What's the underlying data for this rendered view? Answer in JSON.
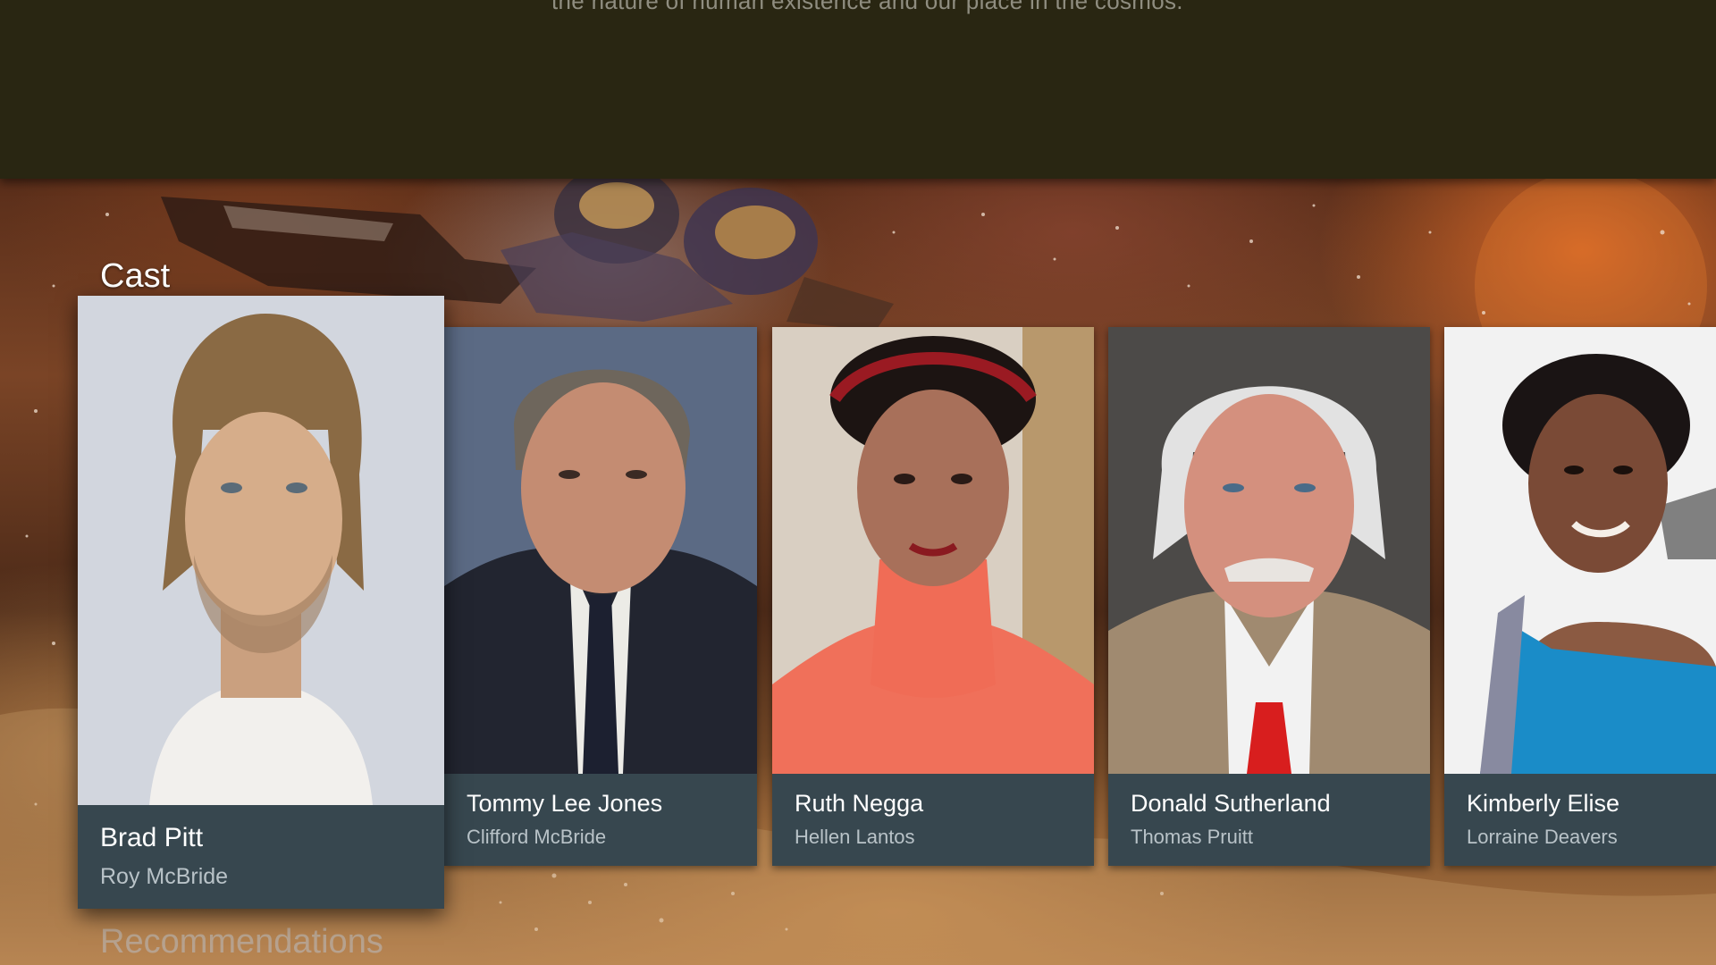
{
  "overview": {
    "text": "the nature of human existence and our place in the cosmos."
  },
  "sections": {
    "cast_title": "Cast",
    "recommendations_title": "Recommendations"
  },
  "cast": [
    {
      "actor": "Brad Pitt",
      "character": "Roy McBride"
    },
    {
      "actor": "Tommy Lee Jones",
      "character": "Clifford McBride"
    },
    {
      "actor": "Ruth Negga",
      "character": "Hellen Lantos"
    },
    {
      "actor": "Donald Sutherland",
      "character": "Thomas Pruitt"
    },
    {
      "actor": "Kimberly Elise",
      "character": "Lorraine Deavers"
    }
  ],
  "colors": {
    "band": "#292612",
    "card_caption": "#37474f",
    "actor_text": "#ffffff",
    "character_text": "#b9c3c8"
  }
}
